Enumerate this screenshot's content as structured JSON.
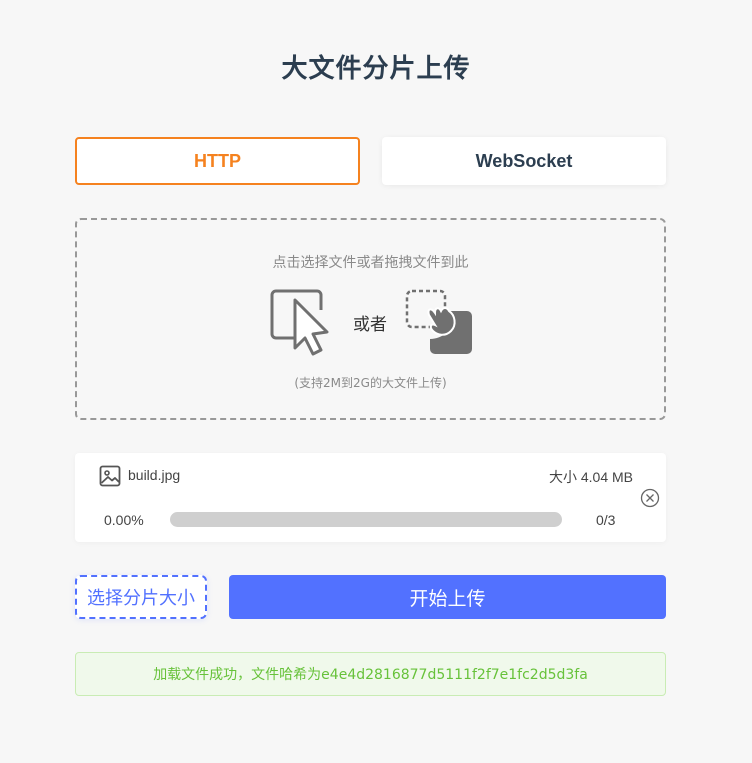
{
  "page": {
    "title": "大文件分片上传"
  },
  "tabs": [
    {
      "label": "HTTP",
      "active": true
    },
    {
      "label": "WebSocket",
      "active": false
    }
  ],
  "dropzone": {
    "hint": "点击选择文件或者拖拽文件到此",
    "or_text": "或者",
    "note": "(支持2M到2G的大文件上传)",
    "icons": [
      "cursor-click-icon",
      "drag-drop-icon"
    ]
  },
  "file": {
    "name": "build.jpg",
    "size_text": "大小 4.04 MB",
    "progress_text": "0.00%",
    "progress_fraction": 0.0,
    "chunks_text": "0/3",
    "icon": "image-icon"
  },
  "buttons": {
    "chunk_size": "选择分片大小",
    "start_upload": "开始上传"
  },
  "alert": {
    "message": "加载文件成功，文件哈希为e4e4d2816877d5111f2f7e1fc2d5d3fa"
  },
  "colors": {
    "accent_orange": "#f5821f",
    "primary_blue": "#5271ff",
    "success_green": "#67c23a",
    "success_bg": "#f0f9eb"
  }
}
